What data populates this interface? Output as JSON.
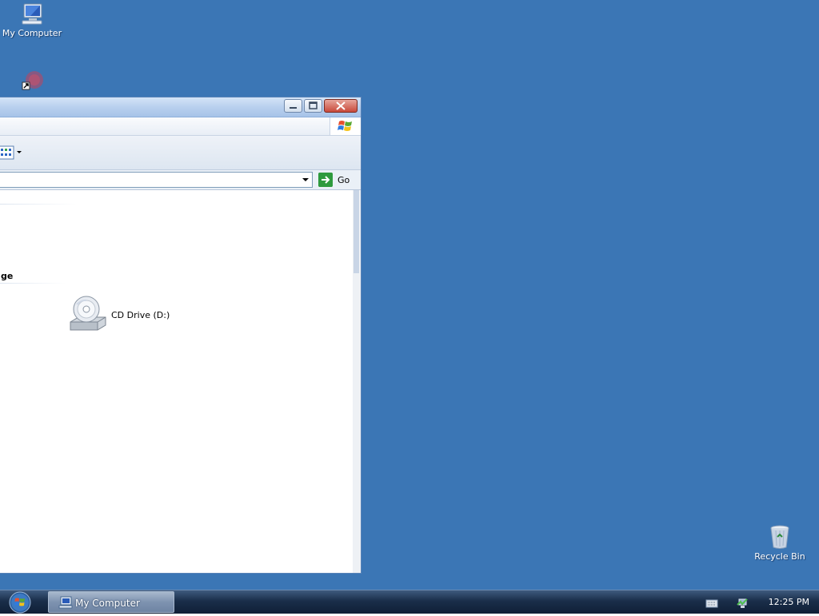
{
  "desktop": {
    "icons": [
      {
        "label": "My Computer",
        "icon": "computer-icon"
      },
      {
        "label": "",
        "icon": "shortcut-icon"
      },
      {
        "label": "Recycle Bin",
        "icon": "recycle-bin-icon"
      }
    ],
    "background_color": "#3b76b5"
  },
  "window": {
    "address": {
      "value": "",
      "go_label": "Go"
    },
    "content": {
      "group_header": "ge",
      "items": [
        {
          "label": "CD Drive (D:)",
          "icon": "cd-drive-icon"
        }
      ]
    }
  },
  "taskbar": {
    "start_icon": "start-orb-icon",
    "tasks": [
      {
        "label": "My Computer",
        "icon": "computer-icon",
        "active": true
      }
    ],
    "tray_icons": [
      "keyboard-icon",
      "network-icon"
    ],
    "clock": "12:25 PM"
  }
}
